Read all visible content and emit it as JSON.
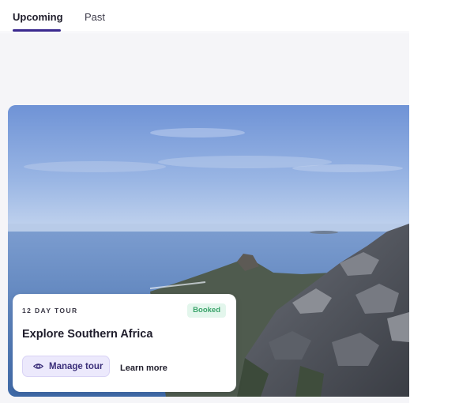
{
  "tabs": [
    {
      "label": "Upcoming",
      "active": true
    },
    {
      "label": "Past",
      "active": false
    }
  ],
  "trip_card": {
    "tour_length": "12 DAY TOUR",
    "status": "Booked",
    "title": "Explore Southern Africa",
    "manage_label": "Manage tour",
    "learn_label": "Learn more",
    "manage_icon": "eye-icon"
  },
  "colors": {
    "accent": "#3b2a8f",
    "badge_bg": "#e3f6ec",
    "badge_text": "#3aa36a",
    "button_bg": "#ece9fc"
  }
}
